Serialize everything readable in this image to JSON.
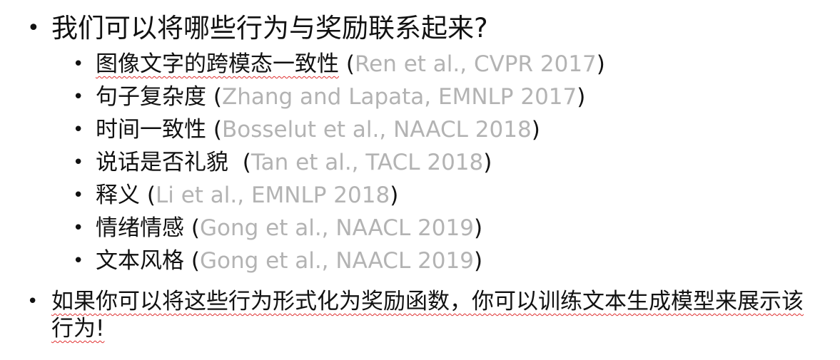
{
  "question": "我们可以将哪些行为与奖励联系起来?",
  "behaviors": [
    {
      "label": "图像文字的跨模态一致性",
      "open": "(",
      "citation": "Ren et al., CVPR 2017",
      "close": ")"
    },
    {
      "label": "句子复杂度",
      "open": "(",
      "citation": "Zhang and Lapata, EMNLP 2017",
      "close": ")"
    },
    {
      "label": "时间一致性",
      "open": "(",
      "citation": "Bosselut et al., NAACL 2018",
      "close": ")"
    },
    {
      "label": "说话是否礼貌",
      "open": "(",
      "citation": "Tan et al., TACL 2018",
      "close": ")"
    },
    {
      "label": "释义",
      "open": "(",
      "citation": "Li et al., EMNLP 2018",
      "close": ")"
    },
    {
      "label": "情绪情感",
      "open": "(",
      "citation": "Gong et al., NAACL 2019",
      "close": ")"
    },
    {
      "label": "文本风格",
      "open": "(",
      "citation": "Gong et al., NAACL 2019",
      "close": ")"
    }
  ],
  "conclusion": "如果你可以将这些行为形式化为奖励函数，你可以训练文本生成模型来展示该行为!"
}
